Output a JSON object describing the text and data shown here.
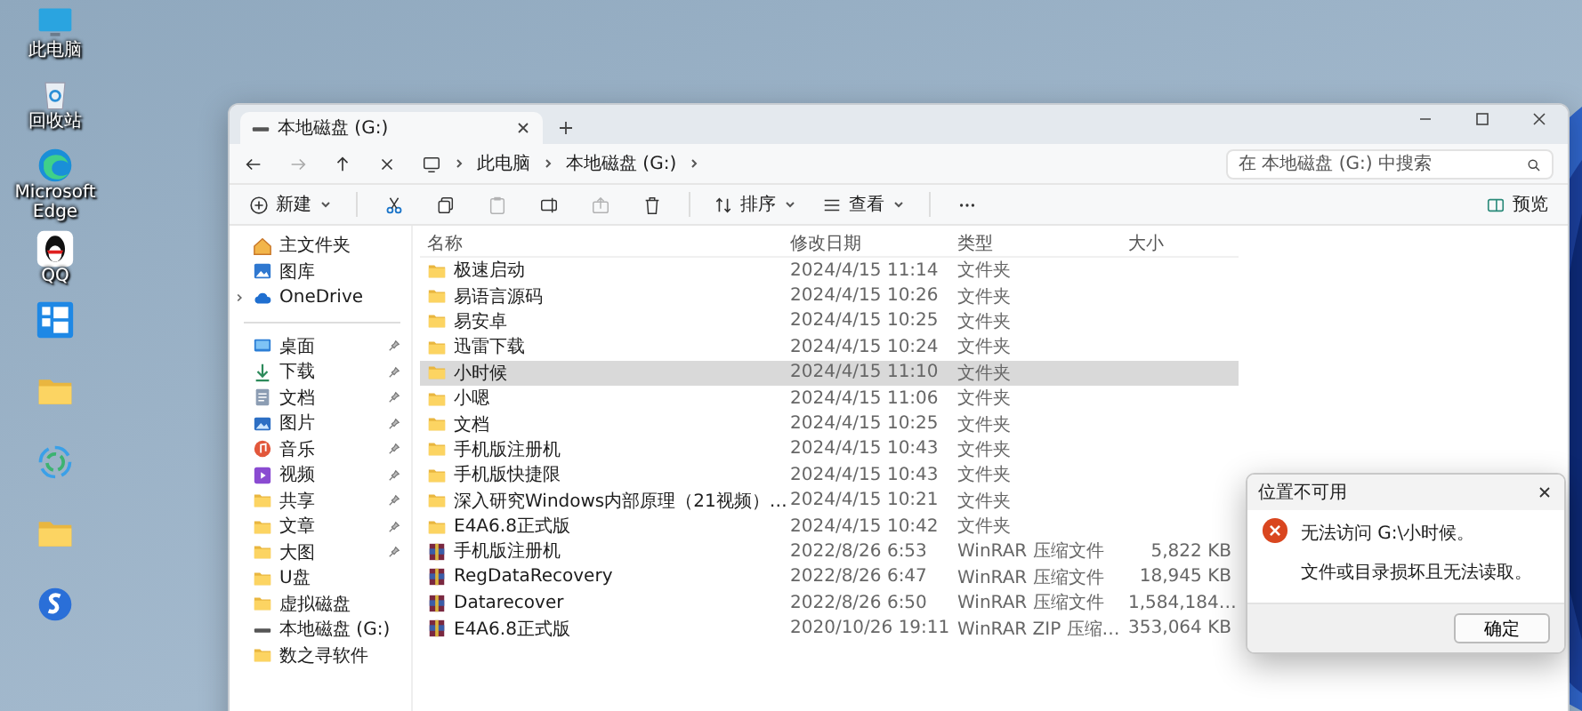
{
  "desktop_icons": [
    {
      "kind": "monitor",
      "label": "此电脑"
    },
    {
      "kind": "recycle",
      "label": "回收站"
    },
    {
      "kind": "edge",
      "label": "Microsoft Edge"
    },
    {
      "kind": "penguin",
      "label": "QQ"
    },
    {
      "kind": "tiles"
    },
    {
      "kind": "folder"
    },
    {
      "kind": "swirl"
    },
    {
      "kind": "folder"
    },
    {
      "kind": "s-logo"
    }
  ],
  "window": {
    "tab": "本地磁盘 (G:)",
    "breadcrumb": [
      "此电脑",
      "本地磁盘 (G:)"
    ],
    "search": {
      "placeholder": "在 本地磁盘 (G:) 中搜索"
    },
    "toolbar": [
      {
        "kind": "new",
        "label": "新建",
        "disabled": false
      },
      {
        "kind": "cut",
        "disabled": false
      },
      {
        "kind": "copy",
        "disabled": false
      },
      {
        "kind": "paste",
        "disabled": true
      },
      {
        "kind": "rename",
        "disabled": false
      },
      {
        "kind": "share",
        "disabled": true
      },
      {
        "kind": "delete",
        "disabled": false
      },
      {
        "kind": "sort",
        "label": "排序",
        "disabled": false
      },
      {
        "kind": "view",
        "label": "查看",
        "disabled": false
      },
      {
        "kind": "more",
        "disabled": false
      }
    ],
    "preview": "预览"
  },
  "sidebar": {
    "top": [
      {
        "kind": "home",
        "label": "主文件夹"
      },
      {
        "kind": "gallery",
        "label": "图库"
      },
      {
        "kind": "cloud",
        "label": "OneDrive",
        "expanded": false
      }
    ],
    "quick": [
      {
        "kind": "desktop",
        "label": "桌面",
        "pinned": true
      },
      {
        "kind": "download",
        "label": "下载",
        "pinned": true
      },
      {
        "kind": "document",
        "label": "文档",
        "pinned": true
      },
      {
        "kind": "picture",
        "label": "图片",
        "pinned": true
      },
      {
        "kind": "music",
        "label": "音乐",
        "pinned": true
      },
      {
        "kind": "video",
        "label": "视频",
        "pinned": true
      },
      {
        "kind": "folder",
        "label": "共享",
        "pinned": true
      },
      {
        "kind": "folder",
        "label": "文章",
        "pinned": true
      },
      {
        "kind": "folder",
        "label": "大图",
        "pinned": true
      },
      {
        "kind": "folder",
        "label": "U盘",
        "pinned": false
      },
      {
        "kind": "folder",
        "label": "虚拟磁盘",
        "pinned": false
      },
      {
        "kind": "drive",
        "label": "本地磁盘 (G:)",
        "pinned": false
      },
      {
        "kind": "folder",
        "label": "数之寻软件",
        "pinned": false
      }
    ]
  },
  "table": {
    "columns": [
      "名称",
      "修改日期",
      "类型",
      "大小"
    ],
    "rows": [
      {
        "kind": "folder",
        "name": "极速启动",
        "date": "2024/4/15 11:14",
        "type": "文件夹",
        "selected": false
      },
      {
        "kind": "folder",
        "name": "易语言源码",
        "date": "2024/4/15 10:26",
        "type": "文件夹",
        "selected": false
      },
      {
        "kind": "folder",
        "name": "易安卓",
        "date": "2024/4/15 10:25",
        "type": "文件夹",
        "selected": false
      },
      {
        "kind": "folder",
        "name": "迅雷下载",
        "date": "2024/4/15 10:24",
        "type": "文件夹",
        "selected": false
      },
      {
        "kind": "folder",
        "name": "小时候",
        "date": "2024/4/15 11:10",
        "type": "文件夹",
        "selected": true
      },
      {
        "kind": "folder",
        "name": "小嗯",
        "date": "2024/4/15 11:06",
        "type": "文件夹",
        "selected": false
      },
      {
        "kind": "folder",
        "name": "文档",
        "date": "2024/4/15 10:25",
        "type": "文件夹",
        "selected": false
      },
      {
        "kind": "folder",
        "name": "手机版注册机",
        "date": "2024/4/15 10:43",
        "type": "文件夹",
        "selected": false
      },
      {
        "kind": "folder",
        "name": "手机版快捷限",
        "date": "2024/4/15 10:43",
        "type": "文件夹",
        "selected": false
      },
      {
        "kind": "folder",
        "name": "深入研究Windows内部原理（21视频）…",
        "date": "2024/4/15 10:21",
        "type": "文件夹",
        "selected": false
      },
      {
        "kind": "folder",
        "name": "E4A6.8正式版",
        "date": "2024/4/15 10:42",
        "type": "文件夹",
        "selected": false
      },
      {
        "kind": "archive",
        "name": "手机版注册机",
        "date": "2022/8/26 6:53",
        "type": "WinRAR 压缩文件",
        "size": "5,822 KB",
        "selected": false
      },
      {
        "kind": "archive",
        "name": "RegDataRecovery",
        "date": "2022/8/26 6:47",
        "type": "WinRAR 压缩文件",
        "size": "18,945 KB",
        "selected": false
      },
      {
        "kind": "archive",
        "name": "Datarecover",
        "date": "2022/8/26 6:50",
        "type": "WinRAR 压缩文件",
        "size": "1,584,184…",
        "selected": false
      },
      {
        "kind": "archive",
        "name": "E4A6.8正式版",
        "date": "2020/10/26 19:11",
        "type": "WinRAR ZIP 压缩…",
        "size": "353,064 KB",
        "selected": false
      }
    ]
  },
  "dialog": {
    "title": "位置不可用",
    "kind": "error",
    "messages": [
      "无法访问 G:\\小时候。",
      "文件或目录损坏且无法读取。"
    ],
    "button": "确定"
  }
}
